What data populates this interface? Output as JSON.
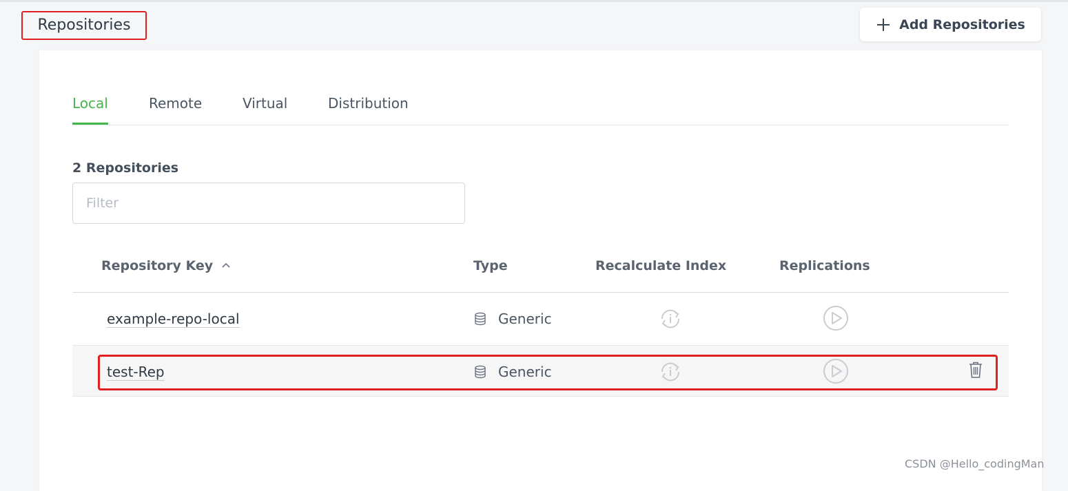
{
  "header": {
    "title": "Repositories",
    "add_button_label": "Add Repositories"
  },
  "tabs": [
    {
      "label": "Local",
      "active": true
    },
    {
      "label": "Remote",
      "active": false
    },
    {
      "label": "Virtual",
      "active": false
    },
    {
      "label": "Distribution",
      "active": false
    }
  ],
  "list": {
    "count_label": "2 Repositories",
    "filter_placeholder": "Filter",
    "filter_value": "",
    "columns": {
      "key": "Repository Key",
      "type": "Type",
      "recalculate": "Recalculate Index",
      "replications": "Replications"
    },
    "sort": {
      "column": "key",
      "direction": "ascending"
    },
    "rows": [
      {
        "key": "example-repo-local",
        "type": "Generic"
      },
      {
        "key": "test-Rep",
        "type": "Generic"
      }
    ]
  },
  "watermark": "CSDN @Hello_codingMan",
  "colors": {
    "accent": "#43b54b",
    "annotation": "#e02020",
    "text": "#3a4450"
  },
  "icons": {
    "add": "plus-icon",
    "sort": "sort-ascending-icon",
    "type": "database-icon",
    "recalculate": "recalculate-index-icon",
    "replication": "play-circle-icon",
    "delete": "trash-icon"
  }
}
